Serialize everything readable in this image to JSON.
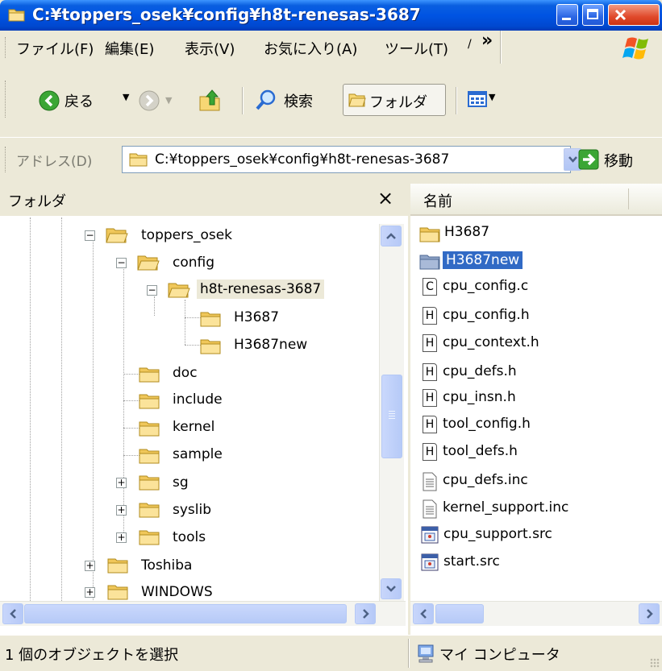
{
  "window": {
    "title": "C:¥toppers_osek¥config¥h8t-renesas-3687",
    "accent": "#0054e3"
  },
  "menu": {
    "items": [
      "ファイル(F)",
      "編集(E)",
      "表示(V)",
      "お気に入り(A)",
      "ツール(T)"
    ],
    "overflow": "»"
  },
  "toolbar": {
    "back_label": "戻る",
    "search_label": "検索",
    "folders_label": "フォルダ"
  },
  "address": {
    "label": "アドレス(D)",
    "value": "C:¥toppers_osek¥config¥h8t-renesas-3687",
    "go_label": "移動"
  },
  "folder_pane": {
    "title": "フォルダ",
    "close": "×",
    "tree": [
      {
        "label": "toppers_osek",
        "expander": "-"
      },
      {
        "label": "config",
        "expander": "-"
      },
      {
        "label": "h8t-renesas-3687",
        "expander": "-",
        "selected": true
      },
      {
        "label": "H3687"
      },
      {
        "label": "H3687new"
      },
      {
        "label": "doc"
      },
      {
        "label": "include"
      },
      {
        "label": "kernel"
      },
      {
        "label": "sample"
      },
      {
        "label": "sg",
        "expander": "+"
      },
      {
        "label": "syslib",
        "expander": "+"
      },
      {
        "label": "tools",
        "expander": "+"
      },
      {
        "label": "Toshiba",
        "expander": "+"
      },
      {
        "label": "WINDOWS",
        "expander": "+"
      }
    ]
  },
  "file_pane": {
    "column_header": "名前",
    "files": [
      {
        "name": "H3687",
        "icon": "folder-icon"
      },
      {
        "name": "H3687new",
        "icon": "folder-icon",
        "selected": true
      },
      {
        "name": "cpu_config.c",
        "icon": "c-file-icon",
        "glyph": "C"
      },
      {
        "name": "cpu_config.h",
        "icon": "h-file-icon",
        "glyph": "H"
      },
      {
        "name": "cpu_context.h",
        "icon": "h-file-icon",
        "glyph": "H"
      },
      {
        "name": "cpu_defs.h",
        "icon": "h-file-icon",
        "glyph": "H"
      },
      {
        "name": "cpu_insn.h",
        "icon": "h-file-icon",
        "glyph": "H"
      },
      {
        "name": "tool_config.h",
        "icon": "h-file-icon",
        "glyph": "H"
      },
      {
        "name": "tool_defs.h",
        "icon": "h-file-icon",
        "glyph": "H"
      },
      {
        "name": "cpu_defs.inc",
        "icon": "text-file-icon"
      },
      {
        "name": "kernel_support.inc",
        "icon": "text-file-icon"
      },
      {
        "name": "cpu_support.src",
        "icon": "src-file-icon"
      },
      {
        "name": "start.src",
        "icon": "src-file-icon"
      }
    ]
  },
  "status": {
    "left": "1 個のオブジェクトを選択",
    "right": "マイ コンピュータ"
  }
}
